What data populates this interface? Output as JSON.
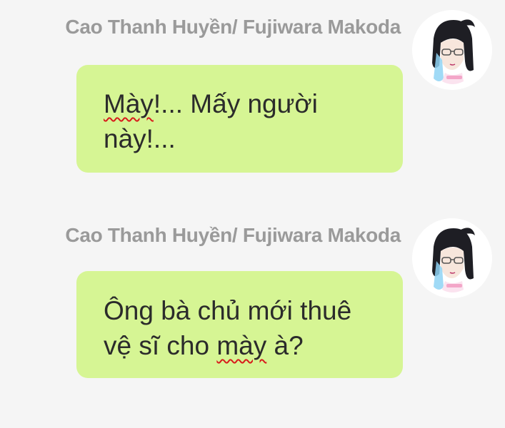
{
  "messages": [
    {
      "sender": "Cao Thanh Huyền/ Fujiwara Makoda",
      "avatar_icon": "avatar-anime-girl-glasses",
      "bubble_color": "#d6f594",
      "lines": [
        {
          "flagged": "Mày",
          "rest": "!... Mấy người"
        },
        {
          "before": "này!...",
          "flagged": "",
          "after": ""
        }
      ]
    },
    {
      "sender": "Cao Thanh Huyền/ Fujiwara Makoda",
      "avatar_icon": "avatar-anime-girl-glasses",
      "bubble_color": "#d6f594",
      "lines": [
        {
          "before": "Ông bà chủ mới thuê"
        },
        {
          "before": "vệ sĩ cho ",
          "flagged": "mày",
          "after": " à?"
        }
      ]
    }
  ],
  "colors": {
    "background": "#f5f5f5",
    "sender_text": "#9a9a9a",
    "spellcheck_underline": "#d81b1b"
  }
}
